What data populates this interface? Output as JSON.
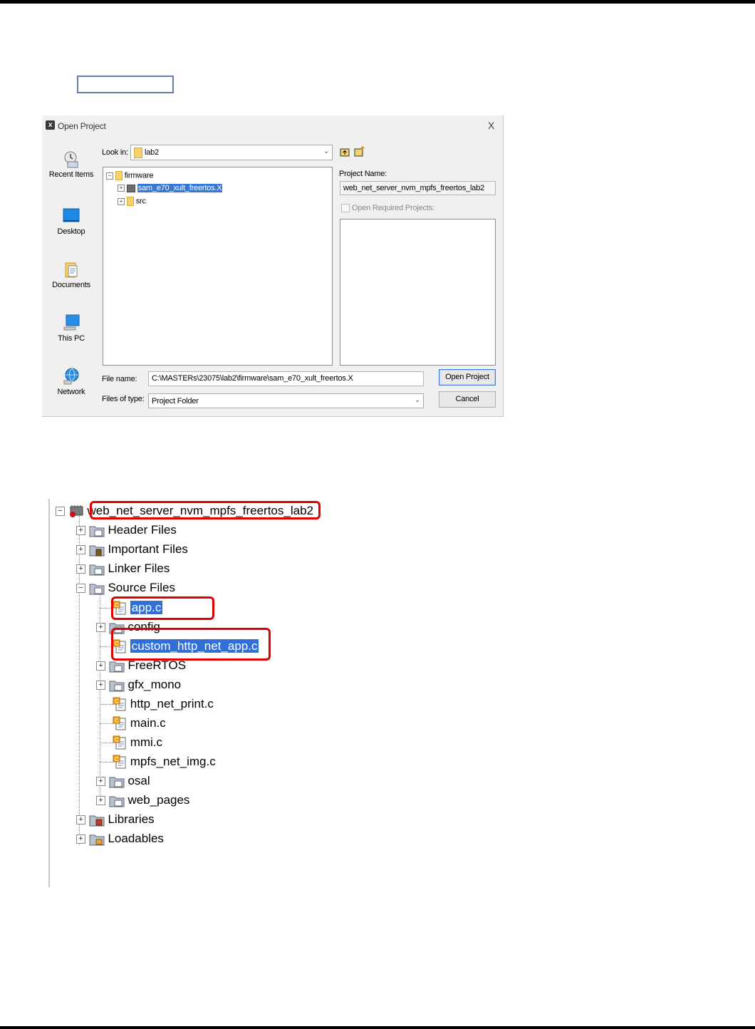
{
  "dialog": {
    "title": "Open Project",
    "close": "X",
    "places": [
      "Recent Items",
      "Desktop",
      "Documents",
      "This PC",
      "Network"
    ],
    "look_in_label": "Look in:",
    "look_in_value": "lab2",
    "tree": {
      "root": "firmware",
      "children": [
        "sam_e70_xult_freertos.X",
        "src"
      ]
    },
    "project_name_label": "Project Name:",
    "project_name_value": "web_net_server_nvm_mpfs_freertos_lab2",
    "open_required_label": "Open Required Projects:",
    "file_name_label": "File name:",
    "file_name_value": "C:\\MASTERs\\23075\\lab2\\firmware\\sam_e70_xult_freertos.X",
    "files_of_type_label": "Files of type:",
    "files_of_type_value": "Project Folder",
    "open_button": "Open Project",
    "cancel_button": "Cancel"
  },
  "project_tree": {
    "root": "web_net_server_nvm_mpfs_freertos_lab2",
    "folders": [
      "Header Files",
      "Important Files",
      "Linker Files",
      "Source Files",
      "Libraries",
      "Loadables"
    ],
    "source_items": [
      "app.c",
      "config",
      "custom_http_net_app.c",
      "FreeRTOS",
      "gfx_mono",
      "http_net_print.c",
      "main.c",
      "mmi.c",
      "mpfs_net_img.c",
      "osal",
      "web_pages"
    ],
    "highlighted": [
      "web_net_server_nvm_mpfs_freertos_lab2",
      "app.c",
      "custom_http_net_app.c"
    ],
    "highlight_color": "#e00000"
  }
}
